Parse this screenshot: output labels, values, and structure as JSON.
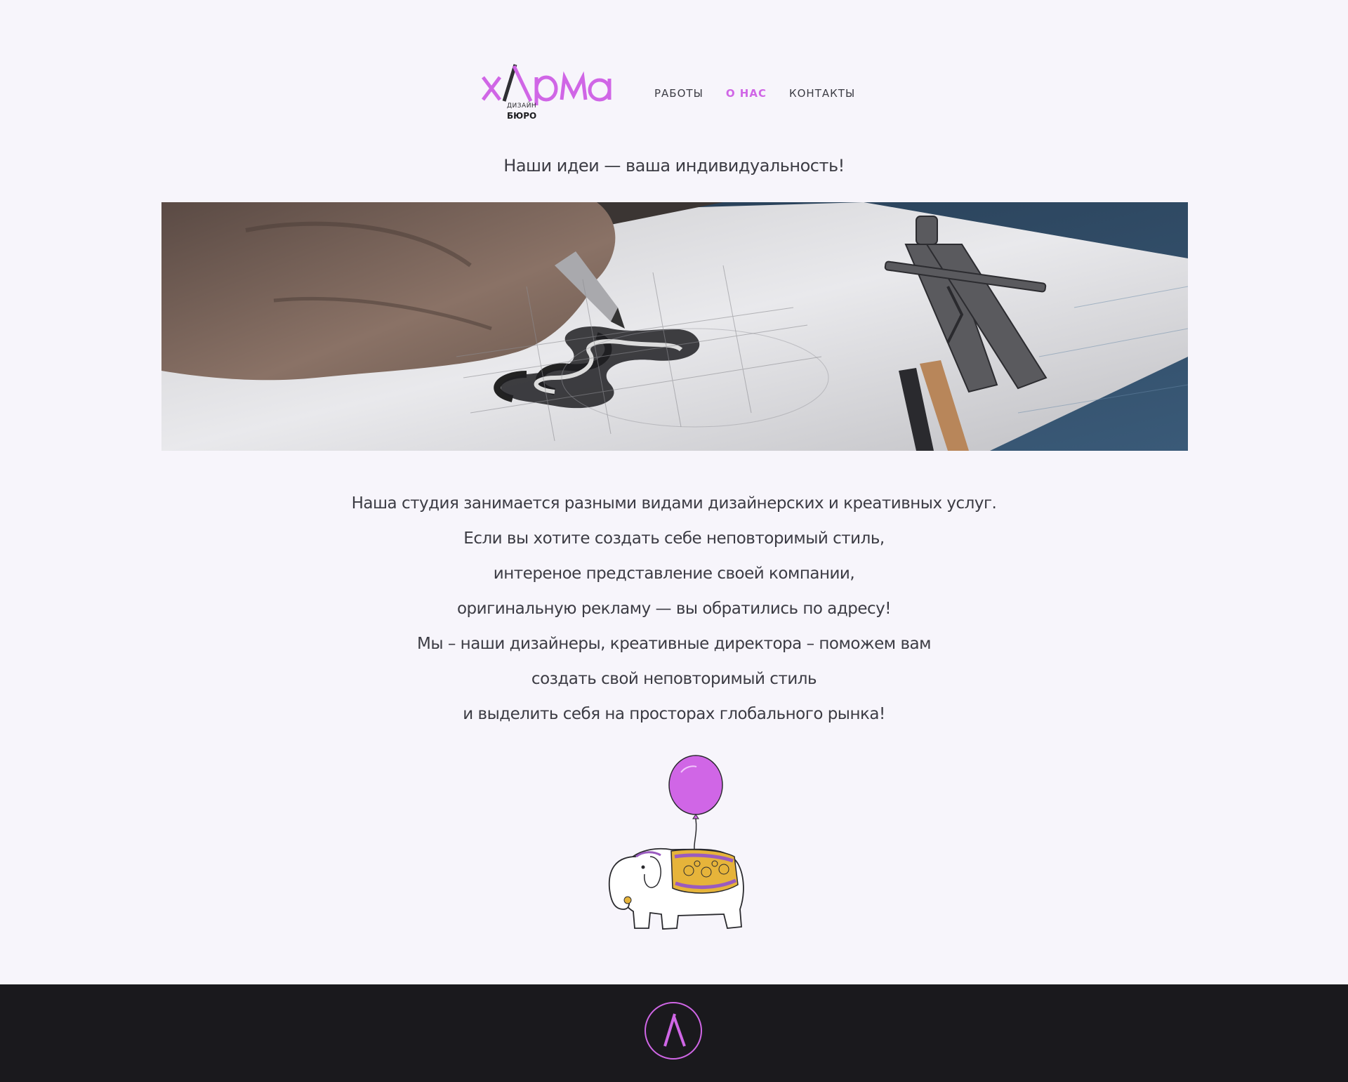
{
  "brand": {
    "logo_text": "хлрма",
    "logo_sub1": "ДИЗАЙН",
    "logo_sub2": "БЮРО",
    "accent_color": "#d066e6",
    "dark_color": "#1a191d"
  },
  "nav": {
    "items": [
      {
        "label": "РАБОТЫ",
        "active": false
      },
      {
        "label": "О НАС",
        "active": true
      },
      {
        "label": "КОНТАКТЫ",
        "active": false
      }
    ]
  },
  "tagline": "Наши идеи — ваша индивидуальность!",
  "hero": {
    "icon": "hand-drawing-logo-photo"
  },
  "about": {
    "lines": [
      "Наша студия занимается разными видами дизайнерских и креативных услуг.",
      "Если вы хотите создать себе неповторимый стиль,",
      "интереное представление своей компании,",
      "оригинальную рекламу — вы обратились по адресу!",
      "Мы – наши дизайнеры, креативные директора – поможем вам",
      "создать свой неповторимый стиль",
      "и выделить себя на просторах глобального рынка!"
    ]
  },
  "illustration": {
    "icon": "elephant-with-balloon-icon"
  },
  "footer": {
    "icon": "lambda-logo-icon"
  }
}
